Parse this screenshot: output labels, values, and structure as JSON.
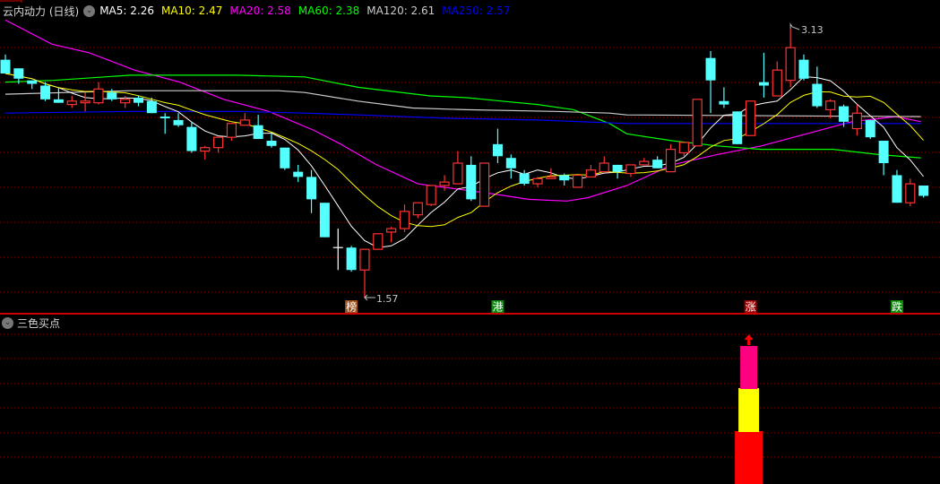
{
  "chart_data": {
    "type": "candlestick",
    "title": "云内动力 (日线)",
    "ylim": [
      1.55,
      3.2
    ],
    "grid": true,
    "colors": {
      "up": "#ff3232",
      "down": "#54ffff",
      "doji": "#ffffff",
      "grid": "#8b0000",
      "separator": "#cc0000"
    },
    "ohlc": [
      [
        2.95,
        2.98,
        2.87,
        2.87
      ],
      [
        2.9,
        2.9,
        2.81,
        2.84
      ],
      [
        2.83,
        2.83,
        2.78,
        2.81
      ],
      [
        2.8,
        2.82,
        2.71,
        2.72
      ],
      [
        2.72,
        2.79,
        2.7,
        2.7
      ],
      [
        2.69,
        2.74,
        2.67,
        2.71
      ],
      [
        2.7,
        2.76,
        2.65,
        2.71
      ],
      [
        2.7,
        2.82,
        2.69,
        2.78
      ],
      [
        2.76,
        2.78,
        2.71,
        2.72
      ],
      [
        2.7,
        2.74,
        2.67,
        2.72
      ],
      [
        2.73,
        2.74,
        2.68,
        2.7
      ],
      [
        2.71,
        2.73,
        2.64,
        2.64
      ],
      [
        2.62,
        2.64,
        2.52,
        2.61
      ],
      [
        2.6,
        2.64,
        2.56,
        2.57
      ],
      [
        2.56,
        2.59,
        2.41,
        2.42
      ],
      [
        2.42,
        2.45,
        2.37,
        2.44
      ],
      [
        2.44,
        2.5,
        2.41,
        2.5
      ],
      [
        2.5,
        2.58,
        2.48,
        2.58
      ],
      [
        2.57,
        2.64,
        2.57,
        2.6
      ],
      [
        2.57,
        2.63,
        2.49,
        2.49
      ],
      [
        2.48,
        2.52,
        2.44,
        2.45
      ],
      [
        2.44,
        2.44,
        2.31,
        2.32
      ],
      [
        2.3,
        2.34,
        2.24,
        2.27
      ],
      [
        2.27,
        2.31,
        2.06,
        2.14
      ],
      [
        2.12,
        2.12,
        1.92,
        1.92
      ],
      [
        1.86,
        1.97,
        1.73,
        1.86
      ],
      [
        1.86,
        1.87,
        1.72,
        1.73
      ],
      [
        1.73,
        1.85,
        1.57,
        1.85
      ],
      [
        1.85,
        1.94,
        1.85,
        1.94
      ],
      [
        1.95,
        1.98,
        1.89,
        1.97
      ],
      [
        1.97,
        2.11,
        1.95,
        2.07
      ],
      [
        2.05,
        2.12,
        2.03,
        2.12
      ],
      [
        2.11,
        2.22,
        2.1,
        2.22
      ],
      [
        2.22,
        2.28,
        2.19,
        2.24
      ],
      [
        2.23,
        2.42,
        2.23,
        2.35
      ],
      [
        2.34,
        2.39,
        2.13,
        2.14
      ],
      [
        2.1,
        2.35,
        2.1,
        2.35
      ],
      [
        2.46,
        2.55,
        2.35,
        2.39
      ],
      [
        2.38,
        2.4,
        2.26,
        2.32
      ],
      [
        2.29,
        2.31,
        2.22,
        2.23
      ],
      [
        2.23,
        2.27,
        2.21,
        2.26
      ],
      [
        2.26,
        2.32,
        2.26,
        2.27
      ],
      [
        2.28,
        2.29,
        2.22,
        2.25
      ],
      [
        2.21,
        2.28,
        2.21,
        2.28
      ],
      [
        2.27,
        2.34,
        2.27,
        2.31
      ],
      [
        2.3,
        2.39,
        2.3,
        2.35
      ],
      [
        2.34,
        2.34,
        2.26,
        2.3
      ],
      [
        2.29,
        2.34,
        2.27,
        2.34
      ],
      [
        2.34,
        2.38,
        2.34,
        2.36
      ],
      [
        2.37,
        2.39,
        2.32,
        2.32
      ],
      [
        2.3,
        2.46,
        2.3,
        2.43
      ],
      [
        2.41,
        2.47,
        2.39,
        2.47
      ],
      [
        2.45,
        2.72,
        2.45,
        2.72
      ],
      [
        2.96,
        3.0,
        2.64,
        2.83
      ],
      [
        2.71,
        2.79,
        2.67,
        2.69
      ],
      [
        2.65,
        2.65,
        2.46,
        2.46
      ],
      [
        2.51,
        2.71,
        2.51,
        2.71
      ],
      [
        2.82,
        2.99,
        2.73,
        2.8
      ],
      [
        2.74,
        2.94,
        2.74,
        2.89
      ],
      [
        2.83,
        3.13,
        2.79,
        3.02
      ],
      [
        2.95,
        2.98,
        2.83,
        2.84
      ],
      [
        2.81,
        2.91,
        2.67,
        2.68
      ],
      [
        2.66,
        2.72,
        2.61,
        2.71
      ],
      [
        2.68,
        2.69,
        2.56,
        2.59
      ],
      [
        2.55,
        2.69,
        2.51,
        2.64
      ],
      [
        2.6,
        2.6,
        2.49,
        2.5
      ],
      [
        2.48,
        2.48,
        2.28,
        2.35
      ],
      [
        2.28,
        2.31,
        2.12,
        2.12
      ],
      [
        2.12,
        2.26,
        2.1,
        2.23
      ],
      [
        2.22,
        2.22,
        2.15,
        2.16
      ]
    ],
    "ma_legend": [
      {
        "key": "ma5",
        "label": "MA5: 2.26",
        "color": "#ffffff"
      },
      {
        "key": "ma10",
        "label": "MA10: 2.47",
        "color": "#ffff00"
      },
      {
        "key": "ma20",
        "label": "MA20: 2.58",
        "color": "#ff00ff"
      },
      {
        "key": "ma60",
        "label": "MA60: 2.38",
        "color": "#00ff00"
      },
      {
        "key": "ma120",
        "label": "MA120: 2.61",
        "color": "#cccccc"
      },
      {
        "key": "ma250",
        "label": "MA250: 2.57",
        "color": "#0000ff"
      }
    ],
    "ma_computed": {
      "ma5": 5,
      "ma10": 10
    },
    "ma_points": {
      "ma20": [
        [
          0,
          3.18
        ],
        [
          3.5,
          3.04
        ],
        [
          6.3,
          2.99
        ],
        [
          9.7,
          2.89
        ],
        [
          13.1,
          2.82
        ],
        [
          16.4,
          2.72
        ],
        [
          19.8,
          2.65
        ],
        [
          23.2,
          2.54
        ],
        [
          25.2,
          2.46
        ],
        [
          27.9,
          2.34
        ],
        [
          31,
          2.23
        ],
        [
          33.9,
          2.2
        ],
        [
          36.8,
          2.17
        ],
        [
          39.3,
          2.14
        ],
        [
          42.2,
          2.13
        ],
        [
          43.8,
          2.15
        ],
        [
          46.7,
          2.22
        ],
        [
          50.1,
          2.34
        ],
        [
          53.5,
          2.4
        ],
        [
          56.8,
          2.45
        ],
        [
          60.2,
          2.52
        ],
        [
          63.6,
          2.59
        ],
        [
          66.9,
          2.62
        ],
        [
          68.8,
          2.59
        ]
      ],
      "ma60": [
        [
          0,
          2.82
        ],
        [
          3.6,
          2.83
        ],
        [
          9.4,
          2.86
        ],
        [
          17.4,
          2.86
        ],
        [
          22.5,
          2.85
        ],
        [
          26.5,
          2.79
        ],
        [
          31.9,
          2.74
        ],
        [
          34.6,
          2.73
        ],
        [
          37.3,
          2.71
        ],
        [
          40,
          2.69
        ],
        [
          42.7,
          2.66
        ],
        [
          45.4,
          2.58
        ],
        [
          46.7,
          2.52
        ],
        [
          50.1,
          2.48
        ],
        [
          53.5,
          2.45
        ],
        [
          56.8,
          2.43
        ],
        [
          62.2,
          2.43
        ],
        [
          65.6,
          2.4
        ],
        [
          68.8,
          2.38
        ]
      ],
      "ma120": [
        [
          0,
          2.75
        ],
        [
          9.4,
          2.77
        ],
        [
          20.5,
          2.77
        ],
        [
          22.5,
          2.76
        ],
        [
          26.5,
          2.71
        ],
        [
          30.6,
          2.67
        ],
        [
          34.6,
          2.66
        ],
        [
          41.3,
          2.65
        ],
        [
          45.4,
          2.64
        ],
        [
          46.7,
          2.63
        ],
        [
          68.8,
          2.62
        ]
      ],
      "ma250": [
        [
          0,
          2.64
        ],
        [
          9.4,
          2.65
        ],
        [
          17.4,
          2.65
        ],
        [
          22.5,
          2.64
        ],
        [
          26.5,
          2.63
        ],
        [
          33.3,
          2.61
        ],
        [
          40,
          2.6
        ],
        [
          46.7,
          2.58
        ],
        [
          68.8,
          2.58
        ]
      ]
    },
    "annotations": {
      "high": {
        "index": 59,
        "value": 3.13,
        "text": "3.13"
      },
      "low": {
        "index": 27,
        "value": 1.57,
        "text": "1.57"
      }
    },
    "markers": [
      {
        "index": 26,
        "text": "榜",
        "color": "#a0521e"
      },
      {
        "index": 37,
        "text": "港",
        "color": "#0a8a0a"
      },
      {
        "index": 56,
        "text": "涨",
        "color": "#a00000"
      },
      {
        "index": 67,
        "text": "跌",
        "color": "#0a8a0a"
      }
    ],
    "indicator": {
      "title": "三色买点",
      "signal_index": 56,
      "segments": [
        {
          "color": "#ff0000",
          "value": 1
        },
        {
          "color": "#ffff00",
          "value": 1
        },
        {
          "color": "#ff0080",
          "value": 1
        }
      ],
      "arrow_color": "#ff0000"
    }
  },
  "icons": {
    "collapse": "chevron-down-icon"
  }
}
